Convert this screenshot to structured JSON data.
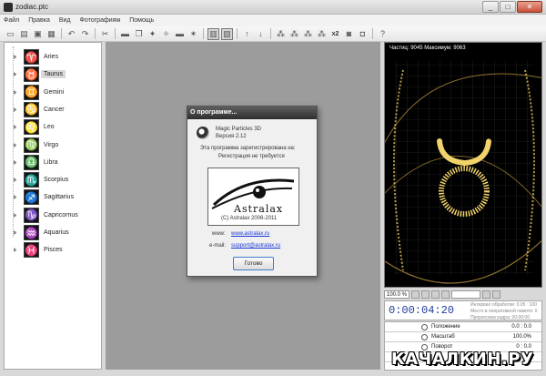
{
  "window": {
    "title": "zodiac.ptc",
    "minimize": "_",
    "maximize": "□",
    "close": "✕"
  },
  "menu": [
    "Файл",
    "Правка",
    "Вид",
    "Фотографиям",
    "Помощь"
  ],
  "toolbar": {
    "icons": [
      "new-icon",
      "open-icon",
      "save-icon",
      "saveas-icon",
      "sep",
      "undo-icon",
      "redo-icon",
      "sep",
      "cut-icon",
      "sep",
      "folder-icon",
      "copy-icon",
      "emitter-icon",
      "emitter2-icon",
      "folder2-icon",
      "emitter3-icon",
      "sep",
      "view1-icon",
      "view2-icon",
      "sep",
      "up-icon",
      "down-icon",
      "sep",
      "particles1-icon",
      "particles2-icon",
      "particles3-icon",
      "particles4-icon",
      "x2",
      "image-icon",
      "image2-icon",
      "sep",
      "help-icon"
    ],
    "x2_label": "x2"
  },
  "tree": {
    "selected": "Taurus",
    "items": [
      {
        "label": "Aries",
        "glyph": "♈"
      },
      {
        "label": "Taurus",
        "glyph": "♉"
      },
      {
        "label": "Gemini",
        "glyph": "♊"
      },
      {
        "label": "Cancer",
        "glyph": "♋"
      },
      {
        "label": "Leo",
        "glyph": "♌"
      },
      {
        "label": "Virgo",
        "glyph": "♍"
      },
      {
        "label": "Libra",
        "glyph": "♎"
      },
      {
        "label": "Scorpius",
        "glyph": "♏"
      },
      {
        "label": "Sagittarius",
        "glyph": "♐"
      },
      {
        "label": "Capricornus",
        "glyph": "♑"
      },
      {
        "label": "Aquarius",
        "glyph": "♒"
      },
      {
        "label": "Pisces",
        "glyph": "♓"
      }
    ]
  },
  "about": {
    "title": "О программе...",
    "product": "Magic Particles 3D",
    "version": "Версия 2.12",
    "line1": "Эта программа зарегистрирована на:",
    "line2": "Регистрация не требуется",
    "banner_word": "Astralax",
    "copyright": "(C) Astralax 2006-2011",
    "www_label": "www:",
    "www_link": "www.astralax.ru",
    "email_label": "e-mail:",
    "email_link": "support@astralax.ru",
    "ok_label": "Готово"
  },
  "preview": {
    "info": "Частиц: 9045   Максимум: 9063",
    "zoom": "100.0 %",
    "timer": "0:00:04:20",
    "meta1": "Интервал обработки: 0.05 : 100",
    "meta2": "Место в оперативной памяти: 0",
    "meta3": "Прорисовка кадра: 00:00:00"
  },
  "params": [
    {
      "name": "Положение",
      "value": "0.0 : 0.0"
    },
    {
      "name": "Масштаб",
      "value": "100.0%"
    },
    {
      "name": "Поворот",
      "value": "0 : 0.0"
    },
    {
      "name": "",
      "value": ""
    }
  ],
  "watermark": "КАЧАЛКИН.РУ"
}
